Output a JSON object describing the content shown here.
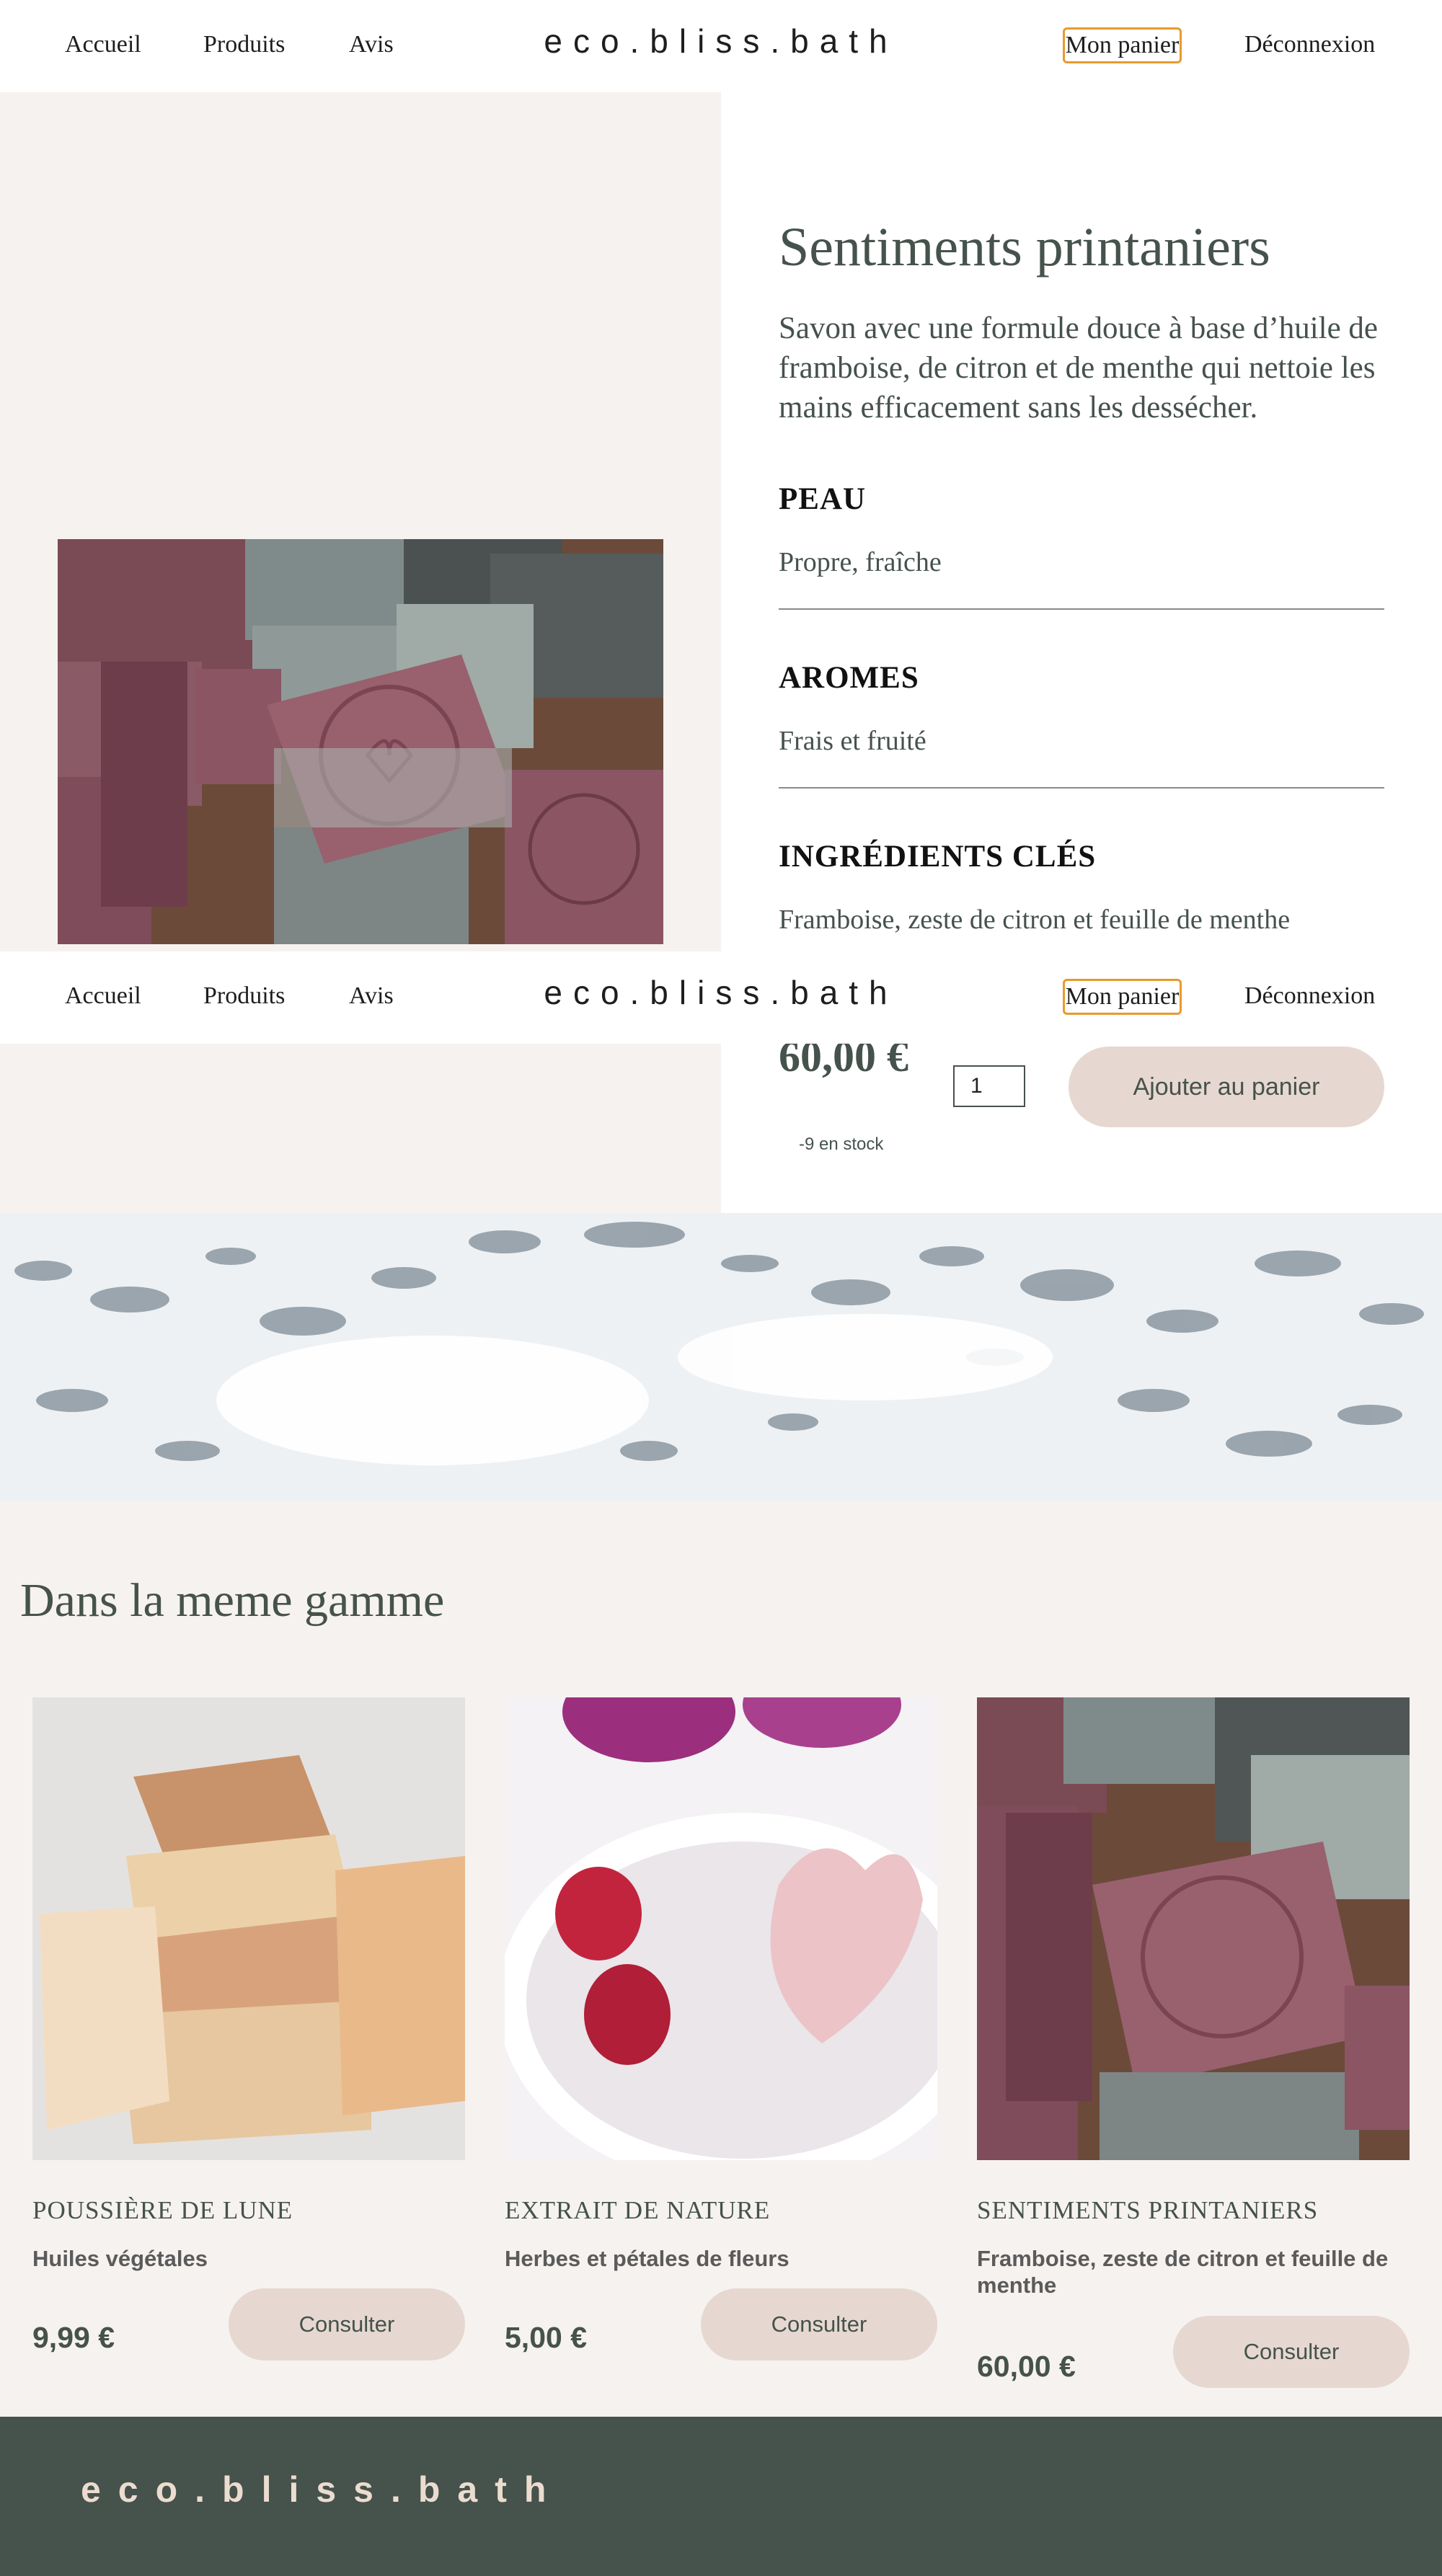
{
  "nav": {
    "links": [
      "Accueil",
      "Produits",
      "Avis"
    ],
    "logo": "eco.bliss.bath",
    "cart": "Mon panier",
    "logout": "Déconnexion"
  },
  "product": {
    "title": "Sentiments printaniers",
    "description": "Savon avec une formule douce à base d’huile de framboise, de citron et de menthe qui nettoie les mains efficacement sans les dessécher.",
    "specs": [
      {
        "label": "PEAU",
        "value": "Propre, fraîche"
      },
      {
        "label": "AROMES",
        "value": "Frais et fruité"
      },
      {
        "label": "INGRÉDIENTS CLÉS",
        "value": "Framboise, zeste de citron et feuille de menthe"
      }
    ],
    "price": "60,00 €",
    "quantity": "1",
    "stock": "-9 en stock",
    "add_button": "Ajouter au panier"
  },
  "similar": {
    "title": "Dans la meme gamme",
    "button_label": "Consulter",
    "items": [
      {
        "name": "POUSSIÈRE DE LUNE",
        "subtitle": "Huiles végétales",
        "price": "9,99 €"
      },
      {
        "name": "EXTRAIT DE NATURE",
        "subtitle": "Herbes et pétales de fleurs",
        "price": "5,00 €"
      },
      {
        "name": "SENTIMENTS PRINTANIERS",
        "subtitle": "Framboise, zeste de citron et feuille de menthe",
        "price": "60,00 €"
      }
    ]
  },
  "footer": {
    "logo": "eco.bliss.bath"
  },
  "colors": {
    "accent": "#e79a2d",
    "dark_green": "#46524c",
    "beige": "#f6f2ef",
    "button": "#e6d8d0"
  }
}
